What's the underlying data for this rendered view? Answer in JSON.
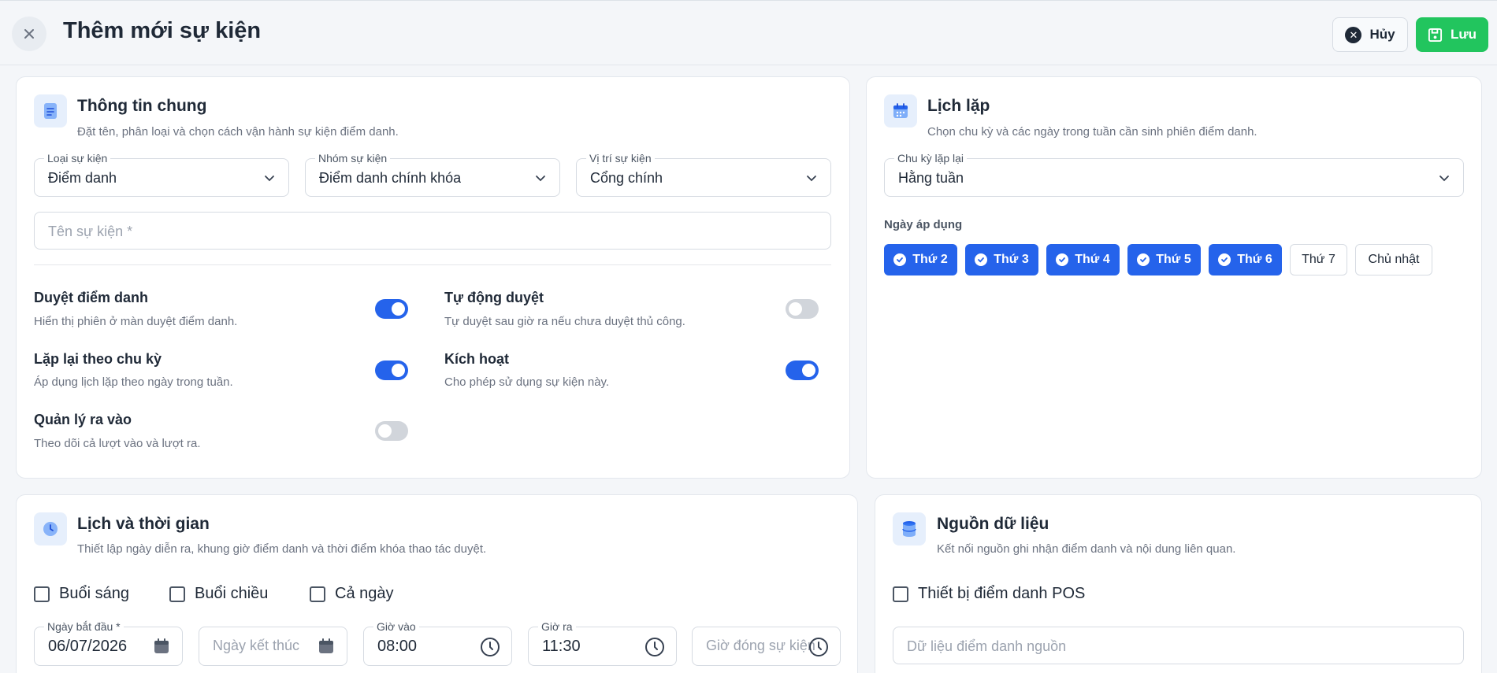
{
  "header": {
    "title": "Thêm mới sự kiện",
    "cancel_label": "Hủy",
    "save_label": "Lưu"
  },
  "general": {
    "title": "Thông tin chung",
    "subtitle": "Đặt tên, phân loại và chọn cách vận hành sự kiện điểm danh.",
    "event_type": {
      "label": "Loại sự kiện",
      "value": "Điểm danh"
    },
    "event_group": {
      "label": "Nhóm sự kiện",
      "value": "Điểm danh chính khóa"
    },
    "event_location": {
      "label": "Vị trí sự kiện",
      "value": "Cổng chính"
    },
    "event_name": {
      "placeholder": "Tên sự kiện *"
    },
    "toggles": [
      {
        "title": "Duyệt điểm danh",
        "desc": "Hiển thị phiên ở màn duyệt điểm danh.",
        "on": true
      },
      {
        "title": "Tự động duyệt",
        "desc": "Tự duyệt sau giờ ra nếu chưa duyệt thủ công.",
        "on": false
      },
      {
        "title": "Lặp lại theo chu kỳ",
        "desc": "Áp dụng lịch lặp theo ngày trong tuần.",
        "on": true
      },
      {
        "title": "Kích hoạt",
        "desc": "Cho phép sử dụng sự kiện này.",
        "on": true
      },
      {
        "title": "Quản lý ra vào",
        "desc": "Theo dõi cả lượt vào và lượt ra.",
        "on": false
      }
    ]
  },
  "repeat": {
    "title": "Lịch lặp",
    "subtitle": "Chọn chu kỳ và các ngày trong tuần cần sinh phiên điểm danh.",
    "cycle": {
      "label": "Chu kỳ lặp lại",
      "value": "Hằng tuần"
    },
    "days_label": "Ngày áp dụng",
    "days": [
      {
        "label": "Thứ 2",
        "selected": true
      },
      {
        "label": "Thứ 3",
        "selected": true
      },
      {
        "label": "Thứ 4",
        "selected": true
      },
      {
        "label": "Thứ 5",
        "selected": true
      },
      {
        "label": "Thứ 6",
        "selected": true
      },
      {
        "label": "Thứ 7",
        "selected": false
      },
      {
        "label": "Chủ nhật",
        "selected": false
      }
    ]
  },
  "schedule": {
    "title": "Lịch và thời gian",
    "subtitle": "Thiết lập ngày diễn ra, khung giờ điểm danh và thời điểm khóa thao tác duyệt.",
    "sessions": [
      "Buổi sáng",
      "Buổi chiều",
      "Cả ngày"
    ],
    "start_date": {
      "label": "Ngày bắt đầu *",
      "value": "06/07/2026"
    },
    "end_date": {
      "placeholder": "Ngày kết thúc"
    },
    "time_in": {
      "label": "Giờ vào",
      "value": "08:00"
    },
    "time_out": {
      "label": "Giờ ra",
      "value": "11:30"
    },
    "close_time": {
      "placeholder": "Giờ đóng sự kiện"
    }
  },
  "source": {
    "title": "Nguồn dữ liệu",
    "subtitle": "Kết nối nguồn ghi nhận điểm danh và nội dung liên quan.",
    "device_label": "Thiết bị điểm danh POS",
    "data_source": {
      "placeholder": "Dữ liệu điểm danh nguồn"
    }
  },
  "colors": {
    "primary": "#2563eb",
    "success": "#22c55e",
    "toggle_off": "#d1d5db"
  }
}
